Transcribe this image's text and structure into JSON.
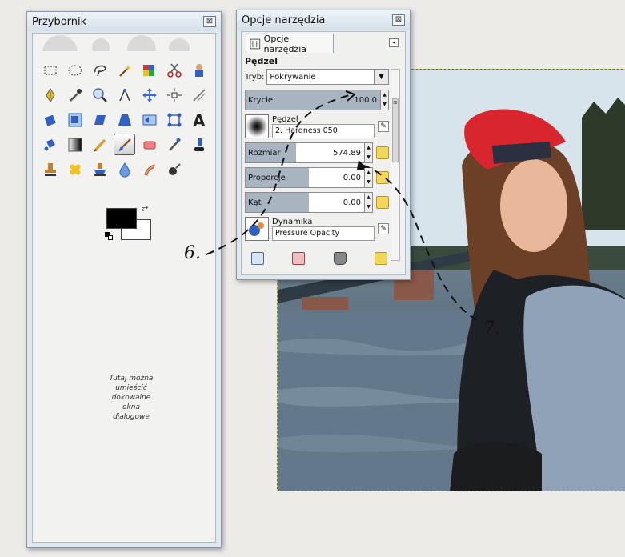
{
  "toolbox": {
    "title": "Przybornik",
    "close_label": "⊠",
    "dock_hint": "Tutaj można umieścić dokowalne okna dialogowe"
  },
  "tool_options": {
    "title": "Opcje narzędzia",
    "close_label": "⊠",
    "tab_label": "Opcje narzędzia",
    "section_title": "Pędzel",
    "mode_label": "Tryb:",
    "mode_value": "Pokrywanie",
    "opacity": {
      "label": "Krycie",
      "value": "100.0",
      "fill": 1.0
    },
    "brush": {
      "label": "Pędzel",
      "value": "2. Hardness 050"
    },
    "size": {
      "label": "Rozmiar",
      "value": "574.89",
      "fill": 0.4
    },
    "aspect": {
      "label": "Proporcje",
      "value": "0.00",
      "fill": 0.5
    },
    "angle": {
      "label": "Kąt",
      "value": "0.00",
      "fill": 0.5
    },
    "dynamics": {
      "label": "Dynamika",
      "value": "Pressure Opacity"
    }
  },
  "annotations": {
    "label_6": "6.",
    "label_7": "7."
  },
  "colors": {
    "foreground": "#000000",
    "background": "#ffffff",
    "cap_red": "#d9262e",
    "accent_yellow": "#f3d75a"
  }
}
